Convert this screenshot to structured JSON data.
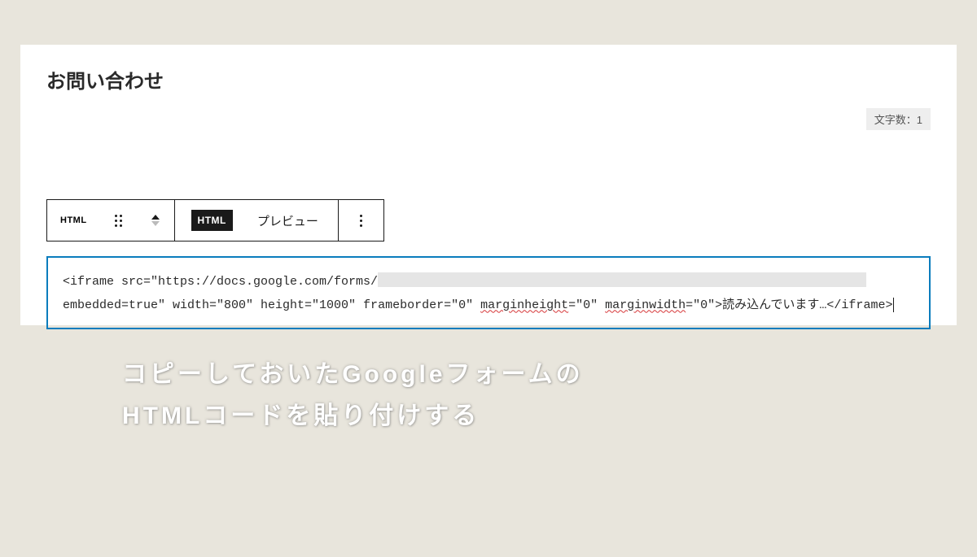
{
  "page": {
    "title": "お問い合わせ"
  },
  "char_count": {
    "label": "文字数：1"
  },
  "toolbar": {
    "block_type_label": "HTML",
    "html_tab": "HTML",
    "preview_tab": "プレビュー"
  },
  "code": {
    "part1": "<iframe src=\"https://docs.google.com/forms/",
    "part2_prefix": "embedded=true\" width=\"800\" height=\"1000\" frameborder=\"0\" ",
    "attr1": "marginheight",
    "mid1": "=\"0\" ",
    "attr2": "marginwidth",
    "part2_suffix": "=\"0\">読み込んでいます…</iframe>"
  },
  "instruction": {
    "line1": "コピーしておいたGoogleフォームの",
    "line2": "HTMLコードを貼り付けする"
  }
}
